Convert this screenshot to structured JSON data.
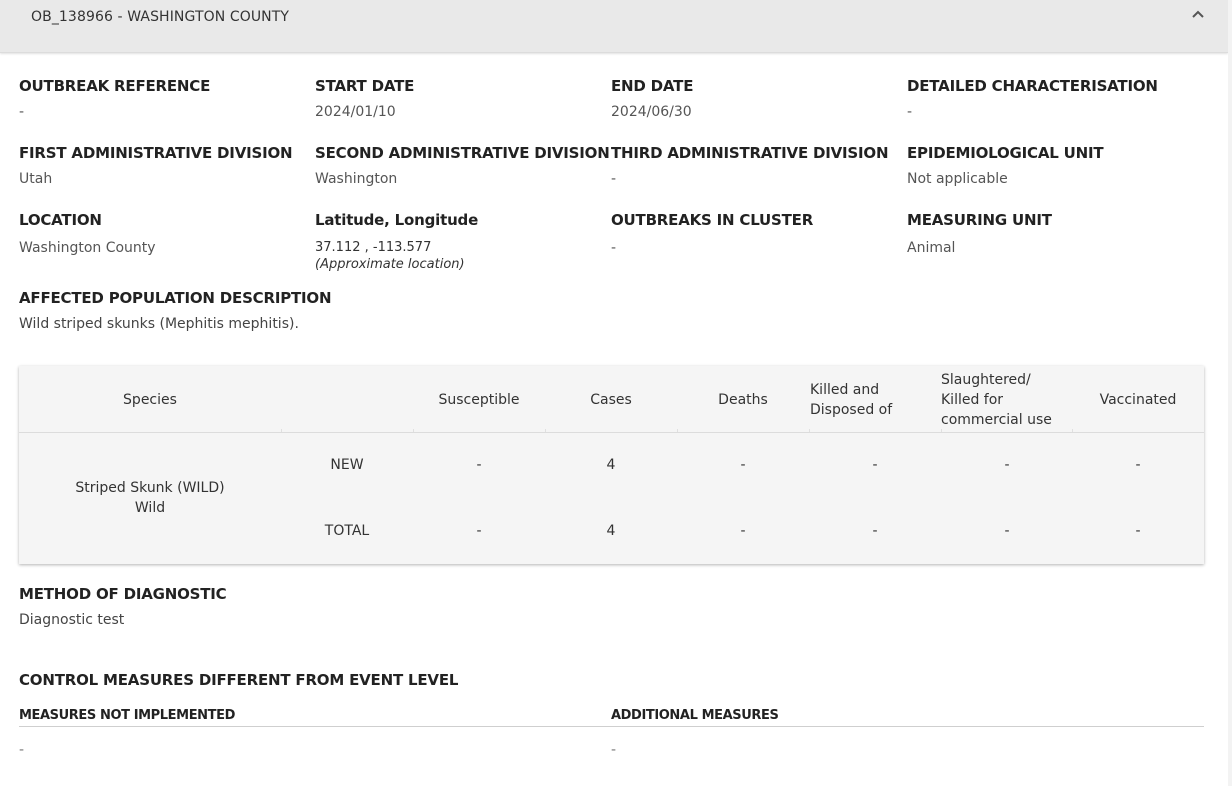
{
  "header": {
    "title": "OB_138966 - WASHINGTON COUNTY",
    "collapse_icon": "chevron-up-icon"
  },
  "fields": {
    "outbreak_reference": {
      "label": "OUTBREAK REFERENCE",
      "value": "-"
    },
    "start_date": {
      "label": "START DATE",
      "value": "2024/01/10"
    },
    "end_date": {
      "label": "END DATE",
      "value": "2024/06/30"
    },
    "detailed_characterisation": {
      "label": "DETAILED CHARACTERISATION",
      "value": "-"
    },
    "first_admin_division": {
      "label": "FIRST ADMINISTRATIVE DIVISION",
      "value": "Utah"
    },
    "second_admin_division": {
      "label": "SECOND ADMINISTRATIVE DIVISION",
      "value": "Washington"
    },
    "third_admin_division": {
      "label": "THIRD ADMINISTRATIVE DIVISION",
      "value": "-"
    },
    "epidemiological_unit": {
      "label": "EPIDEMIOLOGICAL UNIT",
      "value": "Not applicable"
    },
    "location": {
      "label": "LOCATION",
      "value": "Washington County"
    },
    "lat_long": {
      "label": "Latitude, Longitude",
      "value": "37.112 , -113.577",
      "note": "(Approximate location)"
    },
    "outbreaks_in_cluster": {
      "label": "OUTBREAKS IN CLUSTER",
      "value": "-"
    },
    "measuring_unit": {
      "label": "MEASURING UNIT",
      "value": "Animal"
    },
    "affected_population": {
      "label": "AFFECTED POPULATION DESCRIPTION",
      "value": "Wild striped skunks (Mephitis mephitis)."
    }
  },
  "table": {
    "headers": {
      "species": "Species",
      "susceptible": "Susceptible",
      "cases": "Cases",
      "deaths": "Deaths",
      "killed_line1": "Killed and",
      "killed_line2": "Disposed of",
      "slaughtered_line1": "Slaughtered/",
      "slaughtered_line2": "Killed for",
      "slaughtered_line3": "commercial use",
      "vaccinated": "Vaccinated"
    },
    "species_name": "Striped Skunk (WILD)",
    "species_type": "Wild",
    "rows": [
      {
        "label": "NEW",
        "susceptible": "-",
        "cases": "4",
        "deaths": "-",
        "killed": "-",
        "slaughtered": "-",
        "vaccinated": "-"
      },
      {
        "label": "TOTAL",
        "susceptible": "-",
        "cases": "4",
        "deaths": "-",
        "killed": "-",
        "slaughtered": "-",
        "vaccinated": "-"
      }
    ]
  },
  "diagnostic": {
    "label": "METHOD OF DIAGNOSTIC",
    "value": "Diagnostic test"
  },
  "control_measures": {
    "title": "CONTROL MEASURES DIFFERENT FROM EVENT LEVEL",
    "not_implemented_label": "MEASURES NOT IMPLEMENTED",
    "not_implemented_value": "-",
    "additional_label": "ADDITIONAL MEASURES",
    "additional_value": "-"
  }
}
